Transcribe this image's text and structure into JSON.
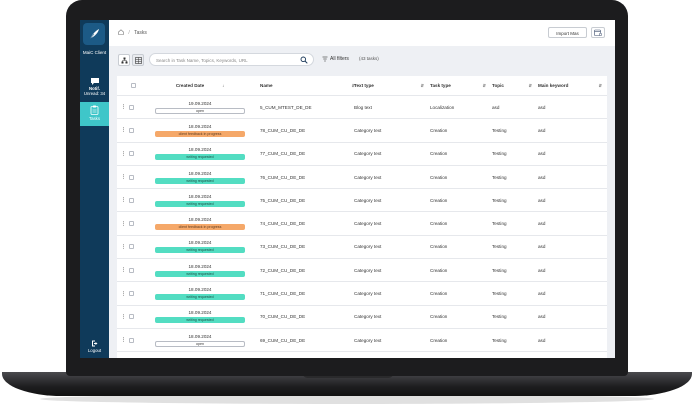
{
  "sidebar": {
    "logo_icon": "quill-feather-icon",
    "logo_label": "MaiC Client",
    "nav": [
      {
        "icon": "chat-bubble-icon",
        "label": "Notif.",
        "sub": "Unread: 34"
      },
      {
        "icon": "clipboard-icon",
        "label": "Tasks"
      }
    ],
    "logout_label": "Logout"
  },
  "breadcrumb": {
    "home_icon": "home-icon",
    "separator": "/",
    "current": "Tasks"
  },
  "header": {
    "import_label": "Import Mas",
    "calendar_icon": "calendar-icon"
  },
  "toolbar": {
    "search_placeholder": "Search in Task Name, Topics, Keywords, URL",
    "filters_label": "All filters",
    "task_count": "(43 tasks)"
  },
  "table": {
    "columns": [
      "Created Date",
      "Name",
      "Text type",
      "Task type",
      "Topic",
      "Main keyword"
    ],
    "rows": [
      {
        "date": "19.09.2024",
        "status": "open",
        "status_type": "open",
        "name": "5_CUM_MTEST_DE_DE",
        "text_type": "Blog text",
        "task_type": "Localization",
        "topic": "asd",
        "keyword": "asd"
      },
      {
        "date": "18.09.2024",
        "status": "client feedback in progress",
        "status_type": "client",
        "name": "78_CUM_CU_DE_DE",
        "text_type": "Category text",
        "task_type": "Creation",
        "topic": "Testing",
        "keyword": "asd"
      },
      {
        "date": "18.09.2024",
        "status": "writing requested",
        "status_type": "writing",
        "name": "77_CUM_CU_DE_DE",
        "text_type": "Category text",
        "task_type": "Creation",
        "topic": "Testing",
        "keyword": "asd"
      },
      {
        "date": "18.09.2024",
        "status": "writing requested",
        "status_type": "writing",
        "name": "76_CUM_CU_DE_DE",
        "text_type": "Category text",
        "task_type": "Creation",
        "topic": "Testing",
        "keyword": "asd"
      },
      {
        "date": "18.09.2024",
        "status": "writing requested",
        "status_type": "writing",
        "name": "75_CUM_CU_DE_DE",
        "text_type": "Category text",
        "task_type": "Creation",
        "topic": "Testing",
        "keyword": "asd"
      },
      {
        "date": "18.09.2024",
        "status": "client feedback in progress",
        "status_type": "client",
        "name": "74_CUM_CU_DE_DE",
        "text_type": "Category text",
        "task_type": "Creation",
        "topic": "Testing",
        "keyword": "asd"
      },
      {
        "date": "18.09.2024",
        "status": "writing requested",
        "status_type": "writing",
        "name": "73_CUM_CU_DE_DE",
        "text_type": "Category text",
        "task_type": "Creation",
        "topic": "Testing",
        "keyword": "asd"
      },
      {
        "date": "18.09.2024",
        "status": "writing requested",
        "status_type": "writing",
        "name": "72_CUM_CU_DE_DE",
        "text_type": "Category text",
        "task_type": "Creation",
        "topic": "Testing",
        "keyword": "asd"
      },
      {
        "date": "18.09.2024",
        "status": "writing requested",
        "status_type": "writing",
        "name": "71_CUM_CU_DE_DE",
        "text_type": "Category text",
        "task_type": "Creation",
        "topic": "Testing",
        "keyword": "asd"
      },
      {
        "date": "18.09.2024",
        "status": "writing requested",
        "status_type": "writing",
        "name": "70_CUM_CU_DE_DE",
        "text_type": "Category text",
        "task_type": "Creation",
        "topic": "Testing",
        "keyword": "asd"
      },
      {
        "date": "18.09.2024",
        "status": "open",
        "status_type": "open",
        "name": "69_CUM_CU_DE_DE",
        "text_type": "Category text",
        "task_type": "Creation",
        "topic": "Testing",
        "keyword": "asd"
      }
    ]
  },
  "colors": {
    "sidebar": "#0f3a5a",
    "accent": "#3fc6c9",
    "badge_client": "#f5a869",
    "badge_writing": "#53ddc2"
  }
}
